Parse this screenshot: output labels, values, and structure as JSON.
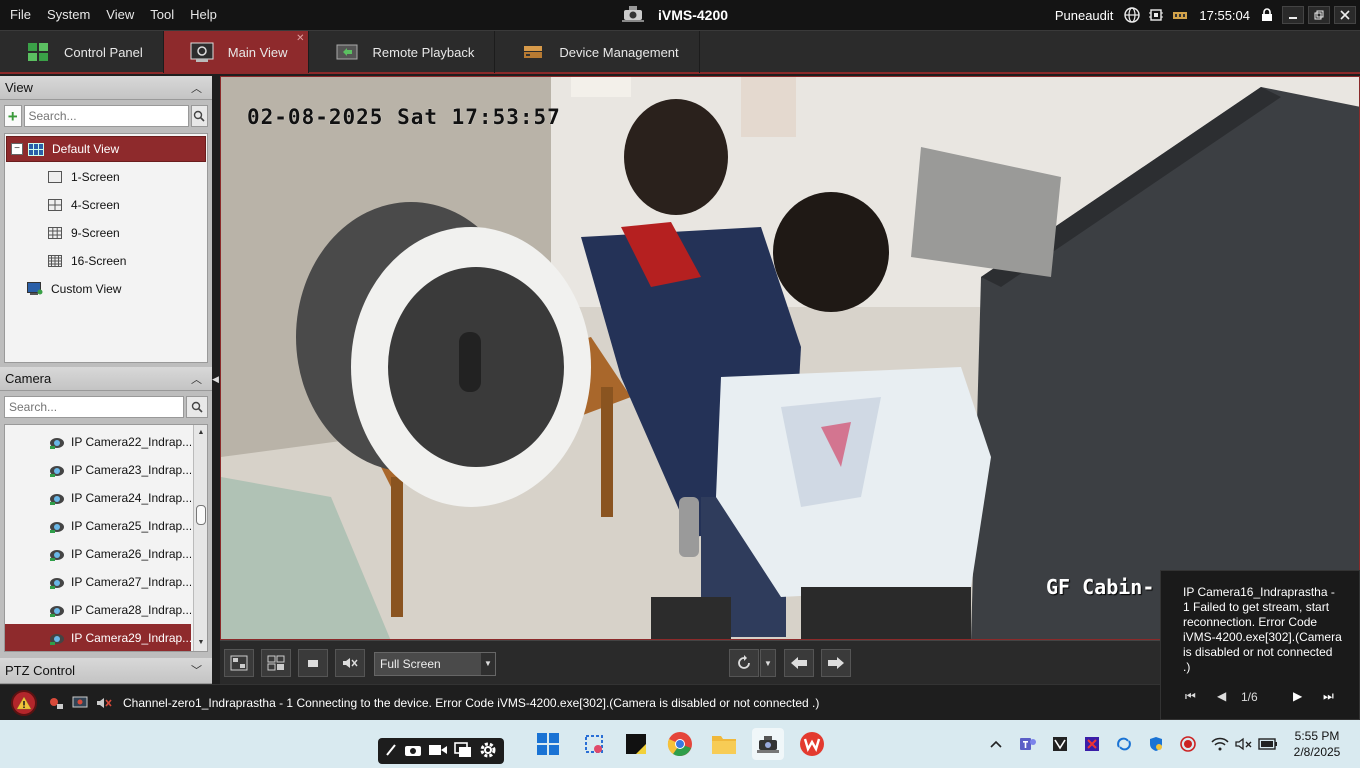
{
  "menu": [
    "File",
    "System",
    "View",
    "Tool",
    "Help"
  ],
  "app": {
    "title": "iVMS-4200"
  },
  "titlebar": {
    "user": "Puneaudit",
    "time": "17:55:04"
  },
  "tabs": [
    {
      "label": "Control Panel",
      "icon": "control-panel-icon",
      "active": false
    },
    {
      "label": "Main View",
      "icon": "main-view-icon",
      "active": true
    },
    {
      "label": "Remote Playback",
      "icon": "remote-playback-icon",
      "active": false
    },
    {
      "label": "Device Management",
      "icon": "device-management-icon",
      "active": false
    }
  ],
  "view_panel": {
    "header": "View",
    "search_placeholder": "Search...",
    "tree": [
      {
        "label": "Default View",
        "level": 0,
        "selected": true
      },
      {
        "label": "1-Screen",
        "level": 1
      },
      {
        "label": "4-Screen",
        "level": 1
      },
      {
        "label": "9-Screen",
        "level": 1
      },
      {
        "label": "16-Screen",
        "level": 1
      },
      {
        "label": "Custom View",
        "level": 0
      }
    ]
  },
  "camera_panel": {
    "header": "Camera",
    "search_placeholder": "Search...",
    "cameras": [
      "IP Camera22_Indrap...",
      "IP Camera23_Indrap...",
      "IP Camera24_Indrap...",
      "IP Camera25_Indrap...",
      "IP Camera26_Indrap...",
      "IP Camera27_Indrap...",
      "IP Camera28_Indrap...",
      "IP Camera29_Indrap..."
    ],
    "selected_index": 7
  },
  "ptz_panel": {
    "header": "PTZ Control"
  },
  "video": {
    "osd_timestamp": "02-08-2025 Sat 17:53:57",
    "osd_channel": "GF Cabin-"
  },
  "controls": {
    "layout_value": "Full Screen"
  },
  "popup": {
    "message": "IP Camera16_Indraprastha - 1 Failed to get stream, start reconnection. Error Code iVMS-4200.exe[302].(Camera is disabled or not connected .)",
    "page": "1/6"
  },
  "status": {
    "message": "Channel-zero1_Indraprastha - 1 Connecting to the device. Error Code iVMS-4200.exe[302].(Camera is disabled or not connected .)"
  },
  "taskbar": {
    "time": "5:55 PM",
    "date": "2/8/2025"
  },
  "colors": {
    "accent": "#8e2a2c",
    "panel": "#bdbdbd",
    "dark": "#2b2b2b"
  }
}
